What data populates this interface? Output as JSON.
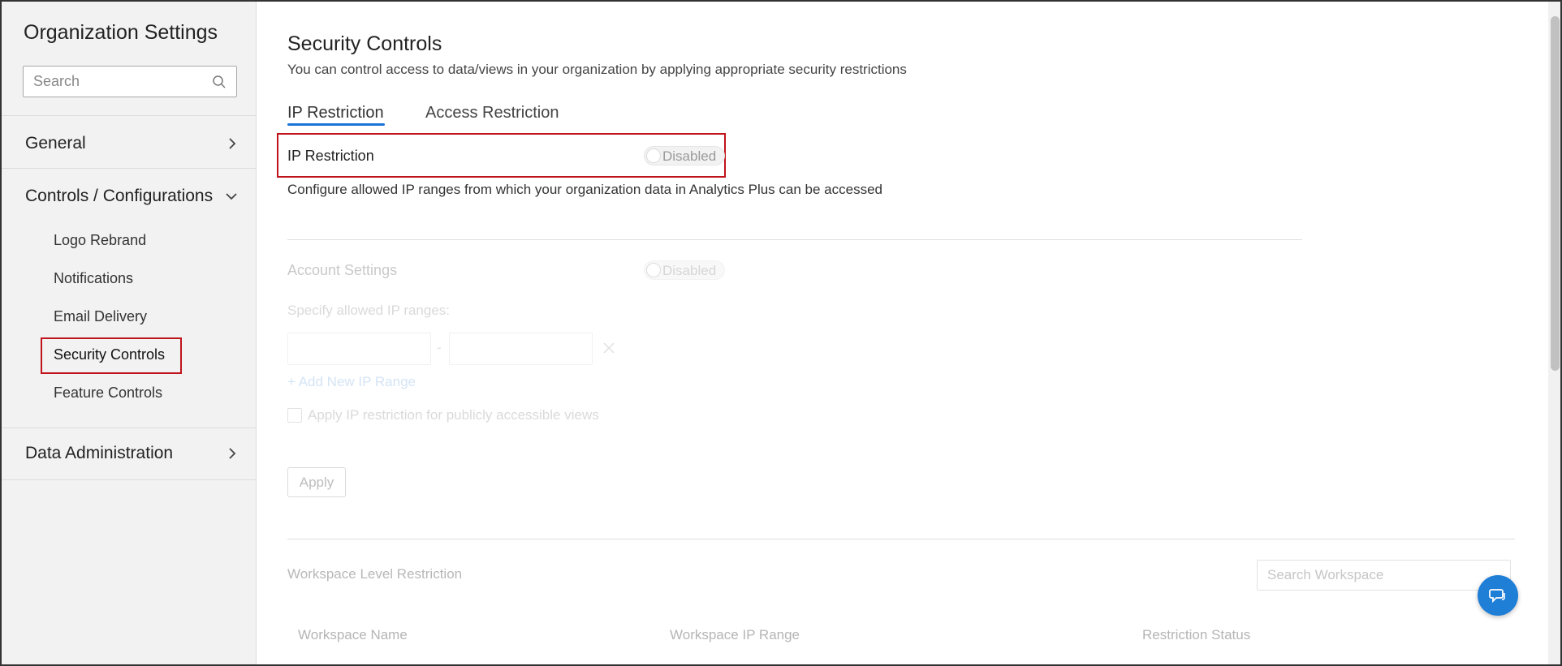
{
  "sidebar": {
    "title": "Organization Settings",
    "search_placeholder": "Search",
    "sections": {
      "general": "General",
      "controls": "Controls / Configurations",
      "data": "Data Administration"
    },
    "sub_items": [
      "Logo Rebrand",
      "Notifications",
      "Email Delivery",
      "Security Controls",
      "Feature Controls"
    ],
    "active_item": "Security Controls"
  },
  "main": {
    "title": "Security Controls",
    "subtitle": "You can control access to data/views in your organization by applying appropriate security restrictions",
    "tabs": [
      "IP Restriction",
      "Access Restriction"
    ],
    "active_tab": "IP Restriction",
    "ip_restriction": {
      "label": "IP Restriction",
      "toggle_state": "Disabled",
      "description": "Configure allowed IP ranges from which your organization data in Analytics Plus can be accessed"
    },
    "account_settings": {
      "label": "Account Settings",
      "toggle_state": "Disabled",
      "ranges_label": "Specify allowed IP ranges:",
      "range_separator": "-",
      "add_range": "+ Add New IP Range",
      "apply_public": "Apply IP restriction for publicly accessible views",
      "apply_button": "Apply"
    },
    "workspace": {
      "title": "Workspace Level Restriction",
      "search_placeholder": "Search Workspace",
      "columns": [
        "Workspace Name",
        "Workspace IP Range",
        "Restriction Status"
      ]
    }
  },
  "colors": {
    "accent": "#1a73d9",
    "highlight": "#c0141c",
    "chat": "#1f7ed6"
  }
}
